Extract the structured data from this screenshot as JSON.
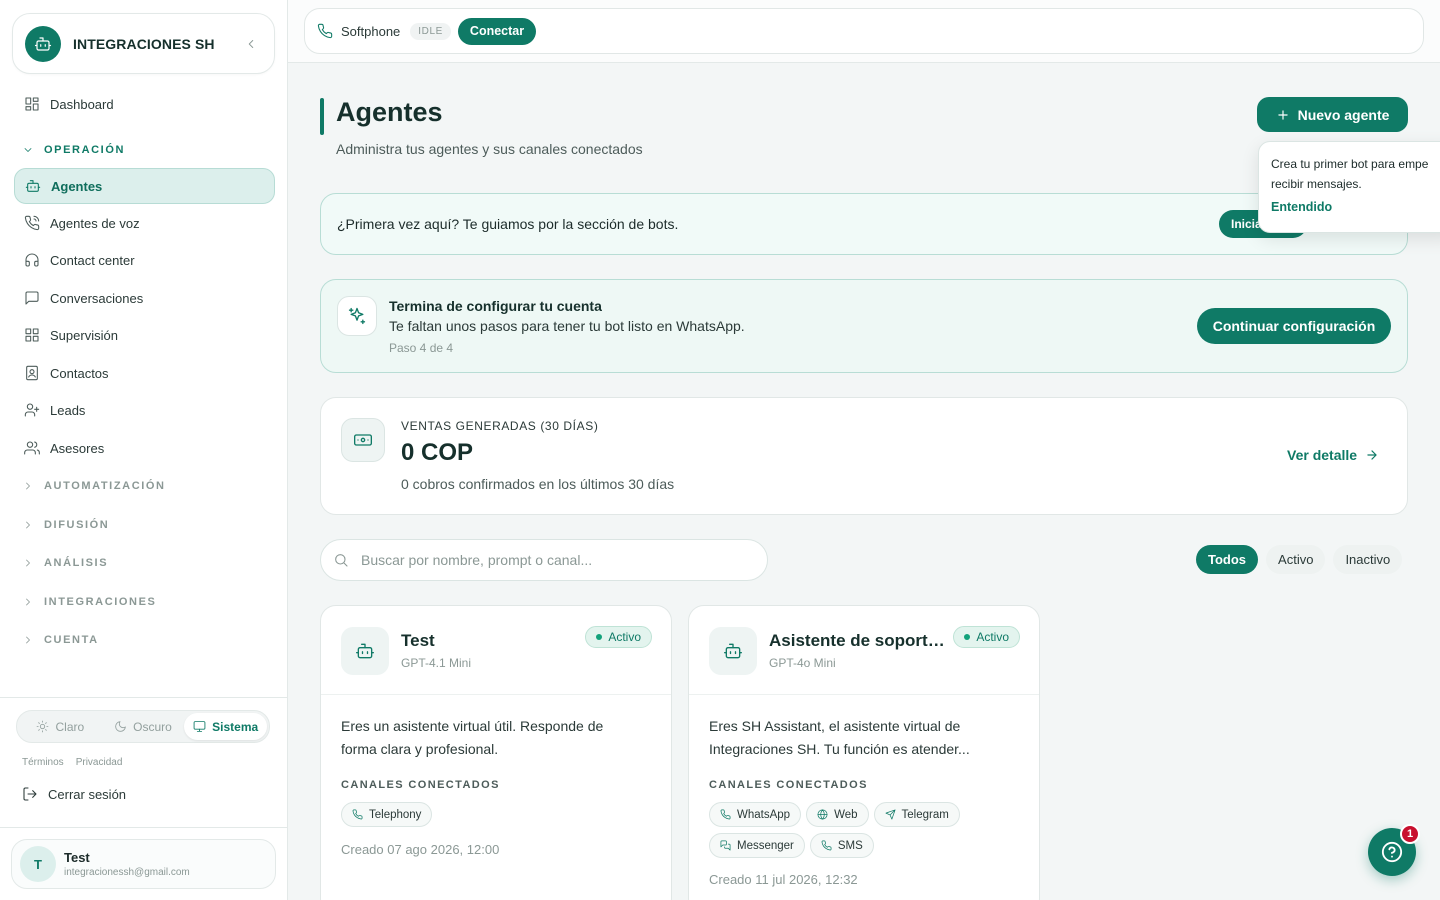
{
  "brand": {
    "name": "INTEGRACIONES SH"
  },
  "sidebar": {
    "items": [
      {
        "label": "Dashboard"
      },
      {
        "label": "Agentes"
      },
      {
        "label": "Agentes de voz"
      },
      {
        "label": "Contact center"
      },
      {
        "label": "Conversaciones"
      },
      {
        "label": "Supervisión"
      },
      {
        "label": "Contactos"
      },
      {
        "label": "Leads"
      },
      {
        "label": "Asesores"
      }
    ],
    "sections": {
      "operacion": "OPERACIÓN",
      "automatizacion": "AUTOMATIZACIÓN",
      "difusion": "DIFUSIÓN",
      "analisis": "ANÁLISIS",
      "integraciones": "INTEGRACIONES",
      "cuenta": "CUENTA"
    },
    "theme": {
      "light": "Claro",
      "dark": "Oscuro",
      "system": "Sistema",
      "selected": "Sistema"
    },
    "legal": {
      "terms": "Términos",
      "privacy": "Privacidad"
    },
    "logout": "Cerrar sesión",
    "user": {
      "initial": "T",
      "name": "Test",
      "email": "integracionessh@gmail.com"
    }
  },
  "softphone": {
    "label": "Softphone",
    "status": "IDLE",
    "connect": "Conectar"
  },
  "header": {
    "title": "Agentes",
    "subtitle": "Administra tus agentes y sus canales conectados",
    "new_agent": "Nuevo agente"
  },
  "tooltip": {
    "text_line1": "Crea tu primer bot para empe",
    "text_line2": "recibir mensajes.",
    "button": "Entendido"
  },
  "guide": {
    "text": "¿Primera vez aquí? Te guiamos por la sección de bots.",
    "button": "Iniciar"
  },
  "setup": {
    "title": "Termina de configurar tu cuenta",
    "description": "Te faltan unos pasos para tener tu bot listo en WhatsApp.",
    "step": "Paso 4 de 4",
    "button": "Continuar configuración"
  },
  "sales": {
    "label": "VENTAS GENERADAS (30 DÍAS)",
    "value": "0 COP",
    "subtitle": "0 cobros confirmados en los últimos 30 días",
    "link": "Ver detalle"
  },
  "search": {
    "placeholder": "Buscar por nombre, prompt o canal...",
    "value": ""
  },
  "filters": [
    {
      "label": "Todos"
    },
    {
      "label": "Activo"
    },
    {
      "label": "Inactivo"
    }
  ],
  "filters_selected": "Todos",
  "channels_label": "CANALES CONECTADOS",
  "agents": [
    {
      "name": "Test",
      "model": "GPT-4.1 Mini",
      "status": "Activo",
      "description": "Eres un asistente virtual útil. Responde de forma clara y profesional.",
      "channels": [
        {
          "label": "Telephony"
        }
      ],
      "created": "Creado 07 ago 2026, 12:00"
    },
    {
      "name": "Asistente de soporte...",
      "model": "GPT-4o Mini",
      "status": "Activo",
      "description": "Eres SH Assistant, el asistente virtual de Integraciones SH. Tu función es atender...",
      "channels": [
        {
          "label": "WhatsApp"
        },
        {
          "label": "Web"
        },
        {
          "label": "Telegram"
        },
        {
          "label": "Messenger"
        },
        {
          "label": "SMS"
        }
      ],
      "created": "Creado 11 jul 2026, 12:32"
    }
  ],
  "help": {
    "notifications": "1"
  },
  "colors": {
    "accent": "#0f7a66",
    "accent_light": "#dcefec",
    "badge": "#c8102e"
  }
}
